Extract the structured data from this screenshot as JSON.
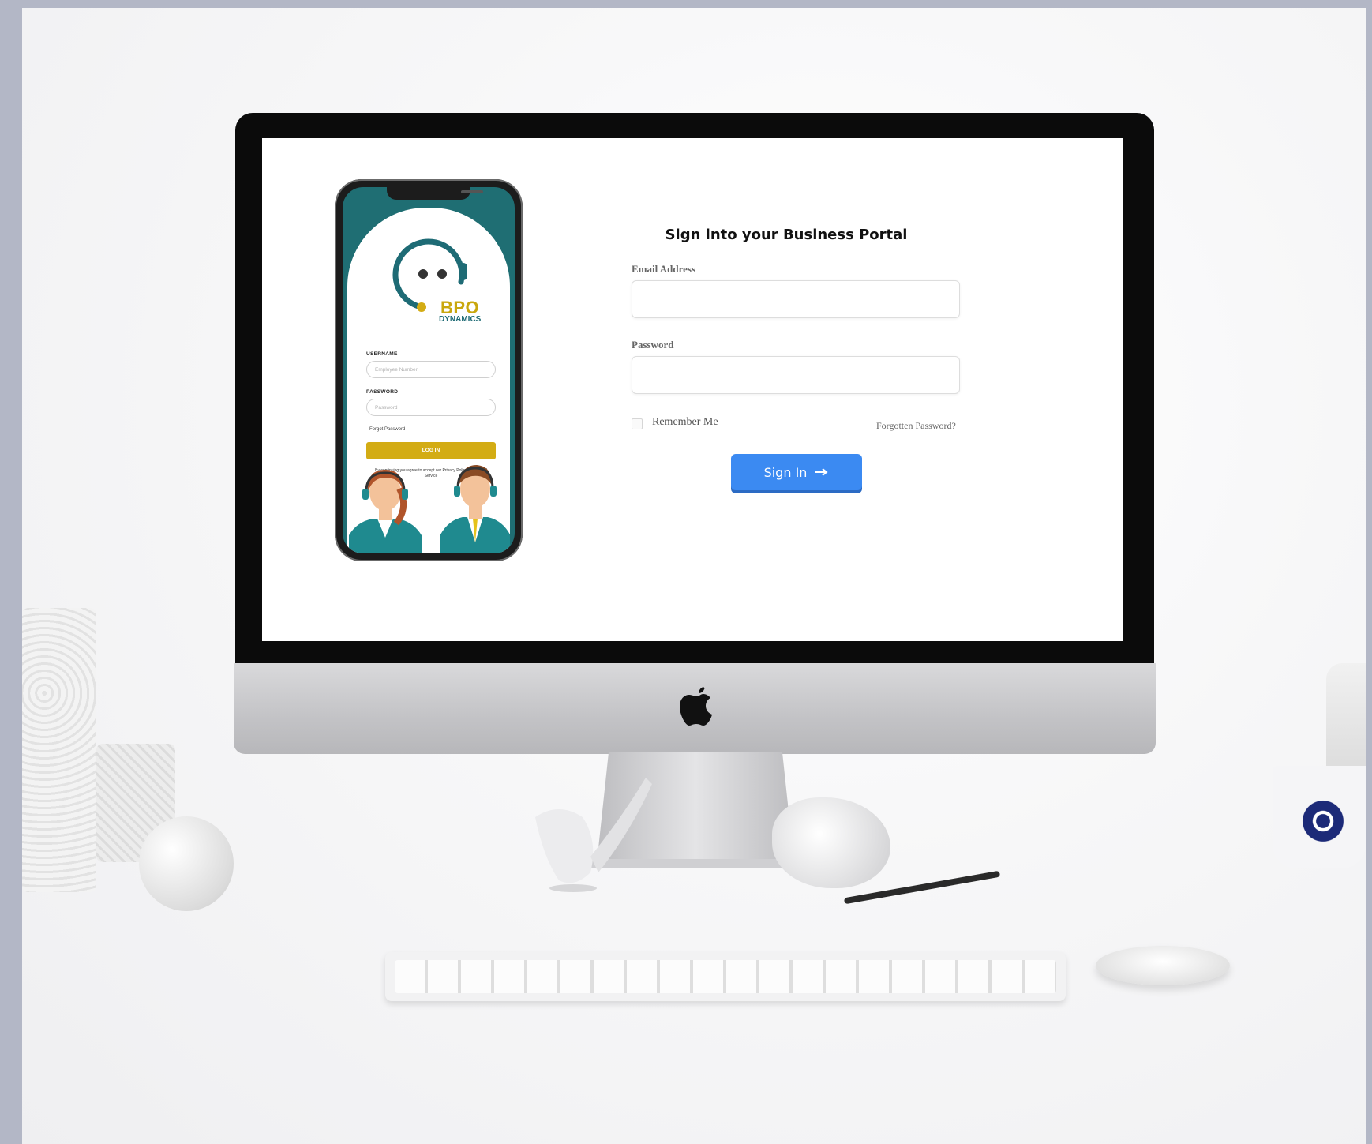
{
  "phone_app": {
    "brand_line1": "BPO",
    "brand_line2": "DYNAMICS",
    "username_label": "USERNAME",
    "username_placeholder": "Employee Number",
    "password_label": "PASSWORD",
    "password_placeholder": "Password",
    "forgot_link": "Forgot Password",
    "login_button": "LOG IN",
    "terms_text": "By continuing you agree to accept our Privacy Policy & Terms of Service",
    "colors": {
      "teal": "#1f6e73",
      "gold": "#d3ac14"
    }
  },
  "portal": {
    "title": "Sign into your Business Portal",
    "email_label": "Email Address",
    "email_value": "",
    "password_label": "Password",
    "password_value": "",
    "remember_label": "Remember Me",
    "remember_checked": false,
    "forgot_link": "Forgotten Password?",
    "signin_button": "Sign In",
    "signin_icon": "arrow-right-icon",
    "colors": {
      "button": "#3b8af2"
    }
  }
}
